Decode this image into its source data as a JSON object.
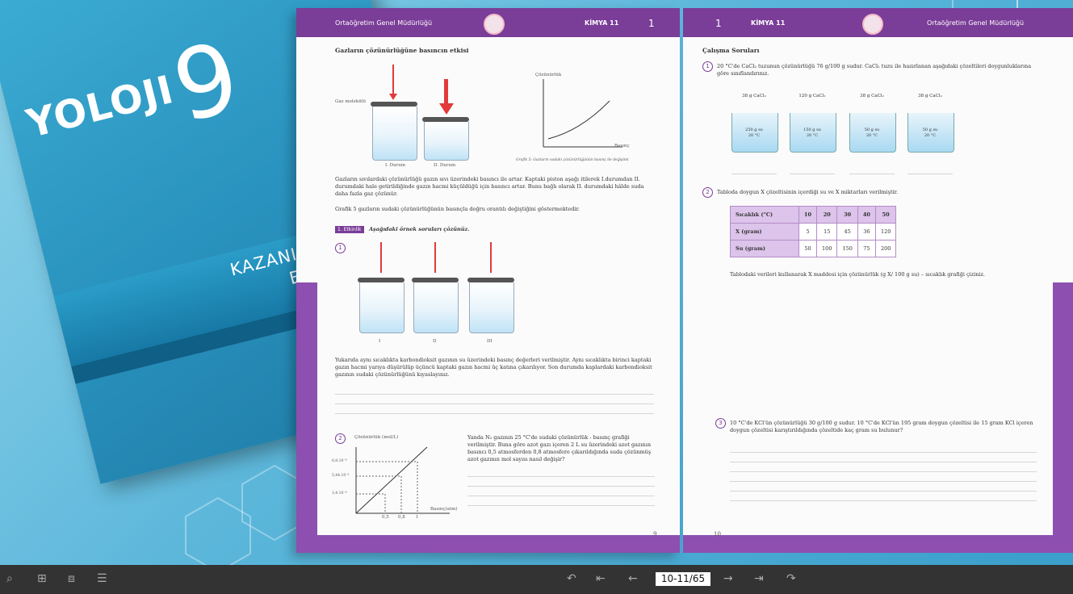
{
  "cover": {
    "title": "YOLOJI",
    "grade": "9",
    "subtitle_line1": "KAZANIM KAVRAMA",
    "subtitle_line2": "ETKİNLİKLERİ"
  },
  "left_page": {
    "header_org": "Ortaöğretim Genel Müdürlüğü",
    "header_subject": "KİMYA 11",
    "header_page_no": "1",
    "section_title": "Gazların çözünürlüğüne basıncın etkisi",
    "label_gas": "Gaz molekülü",
    "state1": "I. Durum",
    "state2": "II. Durum",
    "graph_ylabel": "Çözünürlük",
    "graph_xlabel": "Basınç",
    "graph_caption": "Grafik 5: Gazların sudaki çözünürlüğünün basınç ile değişimi",
    "para1": "Gazların sıvılardaki çözünürlüğü gazın sıvı üzerindeki basıncı ile artar. Kaptaki piston aşağı itilerek I.durumdan II. durumdaki hale getirildiğinde gazın hacmi küçüldüğü için basıncı artar. Bunu bağlı olarak II. durumdaki hâlde suda daha fazla gaz çözünür.",
    "para2": "Grafik 5 gazların sudaki çözünürlüğünün basınçla doğru orantılı değiştiğini göstermektedir.",
    "example_tag": "1. Etkinlik",
    "example_title": "Aşağıdaki örnek soruları çözünüz.",
    "q1_no": "1",
    "q1_labels": [
      "I",
      "II",
      "III"
    ],
    "q1_text": "Yukarıda aynı sıcaklıkta karbondioksit gazının su üzerindeki basınç değerleri verilmiştir. Aynı sıcaklıkta birinci kaptaki gazın hacmi yarıya düşürülüp üçüncü kaptaki gazın hacmi üç katına çıkarılıyor. Son durumda kaplardaki karbondioksit gazının sudaki çözünürlüğünü kıyaslayınız.",
    "q2_no": "2",
    "q2_ylabel": "Çözünürlük (mol/L)",
    "q2_xlabel": "Basınç(atm)",
    "q2_yticks": [
      "6,8.10⁻⁴",
      "5,44.10⁻⁴",
      "3,4.10⁻⁴"
    ],
    "q2_xticks": [
      "0,5",
      "0,8",
      "1"
    ],
    "q2_text": "Yanda N₂ gazının 25 °C'de sudaki çözünürlük - basınç grafiği verilmiştir. Buna göre azot gazı içeren 2 L su üzerindeki azot gazının basıncı 0,5 atmosferden 0,8 atmosfere çıkarıldığında suda çözünmüş azot gazının mol sayısı nasıl değişir?",
    "footer_page": "9"
  },
  "right_page": {
    "header_page_no": "1",
    "header_subject": "KİMYA 11",
    "header_org": "Ortaöğretim Genel Müdürlüğü",
    "section_title": "Çalışma Soruları",
    "q1_no": "1",
    "q1_text": "20 °C'de CaCl₂ tuzunun çözünürlüğü 76 g/100 g sudur. CaCl₂ tuzu ile hazırlanan aşağıdaki çözeltileri doygunluklarına göre sınıflandırınız.",
    "beakers": [
      {
        "top": "38 g CaCl₂",
        "inner1": "250 g su",
        "inner2": "20 °C"
      },
      {
        "top": "120 g CaCl₂",
        "inner1": "150 g su",
        "inner2": "20 °C"
      },
      {
        "top": "38 g CaCl₂",
        "inner1": "50 g su",
        "inner2": "20 °C"
      },
      {
        "top": "38 g CaCl₂",
        "inner1": "50 g su",
        "inner2": "20 °C"
      }
    ],
    "q2_no": "2",
    "q2_text": "Tabloda doygun X çözeltisinin içerdiği su ve X miktarları verilmiştir.",
    "table": {
      "rows": [
        {
          "label": "Sıcaklık (°C)",
          "cells": [
            "10",
            "20",
            "30",
            "40",
            "50"
          ]
        },
        {
          "label": "X (gram)",
          "cells": [
            "5",
            "15",
            "45",
            "36",
            "120"
          ]
        },
        {
          "label": "Su (gram)",
          "cells": [
            "50",
            "100",
            "150",
            "75",
            "200"
          ]
        }
      ]
    },
    "q2_followup": "Tablodaki verileri kullanarak X maddesi için çözünürlük (g X/ 100 g su) – sıcaklık grafiği çiziniz.",
    "q3_no": "3",
    "q3_text": "10 °C'de KCl'ün çözünürlüğü 30 g/100 g sudur. 10 °C'de KCl'ün 195 gram doygun çözeltisi ile 15 gram KCl içeren doygun çözeltisi karıştırıldığında çözeltide kaç gram su bulunur?",
    "footer_page": "10"
  },
  "toolbar": {
    "page_indicator": "10-11/65",
    "icons": [
      "zoom-icon",
      "thumbnails-icon",
      "video-icon",
      "notes-icon",
      "undo-icon",
      "first-page-icon",
      "prev-page-icon",
      "next-page-icon",
      "last-page-icon",
      "redo-icon"
    ]
  },
  "colors": {
    "accent": "#7a3d98",
    "cover": "#2a93bf",
    "toolbar": "#333333"
  }
}
